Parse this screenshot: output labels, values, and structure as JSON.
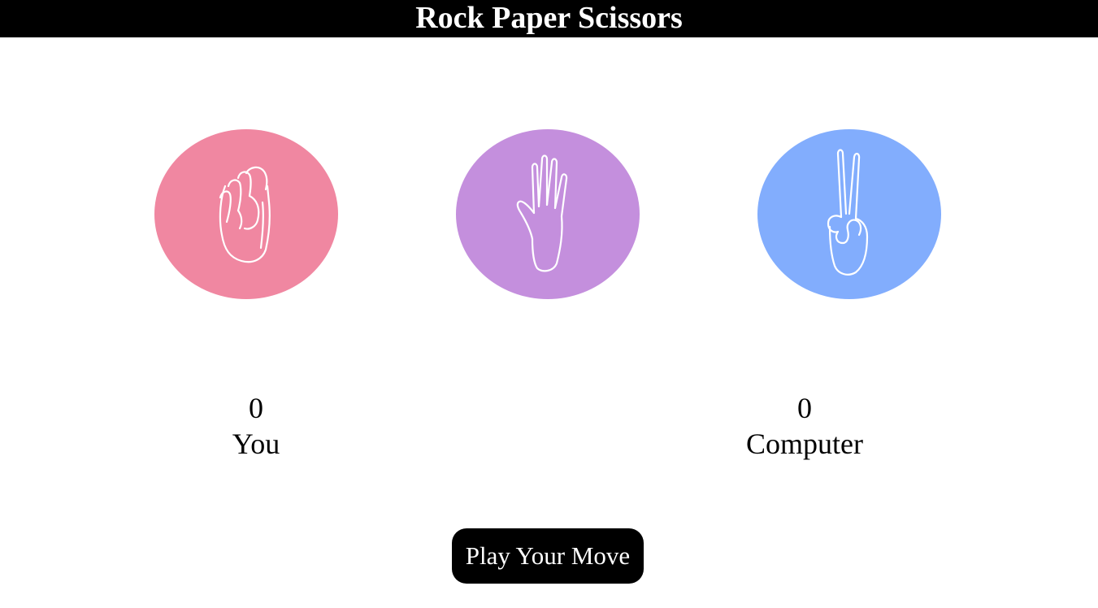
{
  "header": {
    "title": "Rock Paper Scissors"
  },
  "choices": [
    {
      "name": "rock",
      "icon": "fist-icon",
      "color": "#f087a1"
    },
    {
      "name": "paper",
      "icon": "open-hand-icon",
      "color": "#c48fdd"
    },
    {
      "name": "scissors",
      "icon": "peace-hand-icon",
      "color": "#82adfd"
    }
  ],
  "scoreboard": {
    "user": {
      "score": "0",
      "label": "You"
    },
    "computer": {
      "score": "0",
      "label": "Computer"
    }
  },
  "play_button": {
    "label": "Play Your Move"
  }
}
